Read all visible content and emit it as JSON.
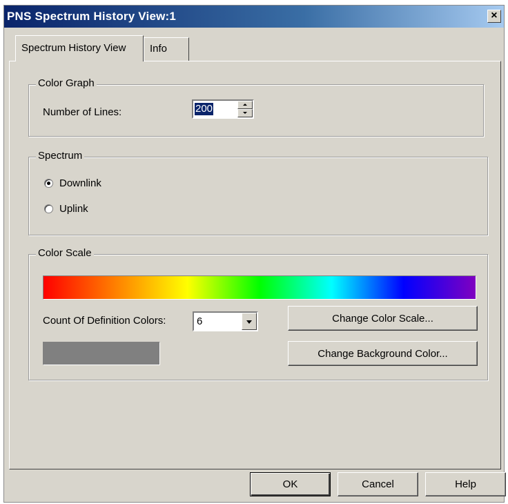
{
  "window": {
    "title": "PNS Spectrum History View:1",
    "close_glyph": "×"
  },
  "tabs": [
    {
      "label": "Spectrum History View",
      "active": true
    },
    {
      "label": "Info",
      "active": false
    }
  ],
  "color_graph": {
    "group_label": "Color Graph",
    "lines_label": "Number of Lines:",
    "lines_value": "200"
  },
  "spectrum": {
    "group_label": "Spectrum",
    "options": [
      {
        "label": "Downlink",
        "selected": true
      },
      {
        "label": "Uplink",
        "selected": false
      }
    ]
  },
  "color_scale": {
    "group_label": "Color Scale",
    "gradient_colors": [
      "#ff0000",
      "#ff8000",
      "#ffff00",
      "#00ff00",
      "#00ffff",
      "#0000ff",
      "#8000c0"
    ],
    "count_label": "Count Of Definition Colors:",
    "count_value": "6",
    "change_scale_label": "Change Color Scale...",
    "change_bg_label": "Change Background Color...",
    "background_color": "#808080"
  },
  "footer": {
    "ok_label": "OK",
    "cancel_label": "Cancel",
    "help_label": "Help"
  },
  "icons": {
    "close": "close-icon",
    "spin_up": "spin-up-arrow-icon",
    "spin_down": "spin-down-arrow-icon",
    "dropdown": "chevron-down-icon"
  }
}
